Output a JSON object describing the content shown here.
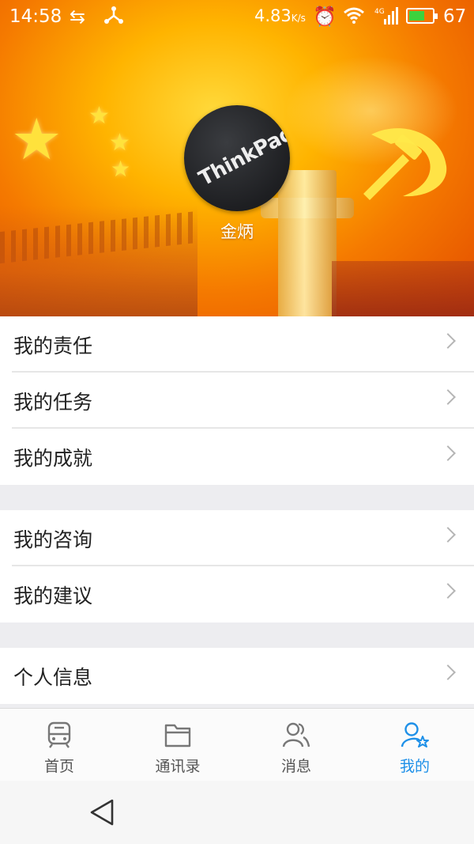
{
  "status_bar": {
    "time": "14:58",
    "speed": "4.83",
    "speed_unit": "K/s",
    "network": "4G",
    "battery_level": 67,
    "battery_text": "67"
  },
  "profile": {
    "avatar_text": "ThinkPad",
    "name": "金炳"
  },
  "menu": {
    "group1": [
      {
        "label": "我的责任"
      },
      {
        "label": "我的任务"
      },
      {
        "label": "我的成就"
      }
    ],
    "group2": [
      {
        "label": "我的咨询"
      },
      {
        "label": "我的建议"
      }
    ],
    "group3": [
      {
        "label": "个人信息"
      }
    ]
  },
  "tabs": [
    {
      "label": "首页",
      "icon": "train-icon"
    },
    {
      "label": "通讯录",
      "icon": "folder-icon"
    },
    {
      "label": "消息",
      "icon": "people-icon"
    },
    {
      "label": "我的",
      "icon": "user-star-icon",
      "active": true
    }
  ],
  "colors": {
    "accent": "#1e90e8",
    "tab_inactive": "#555555",
    "separator": "#ededf0"
  }
}
